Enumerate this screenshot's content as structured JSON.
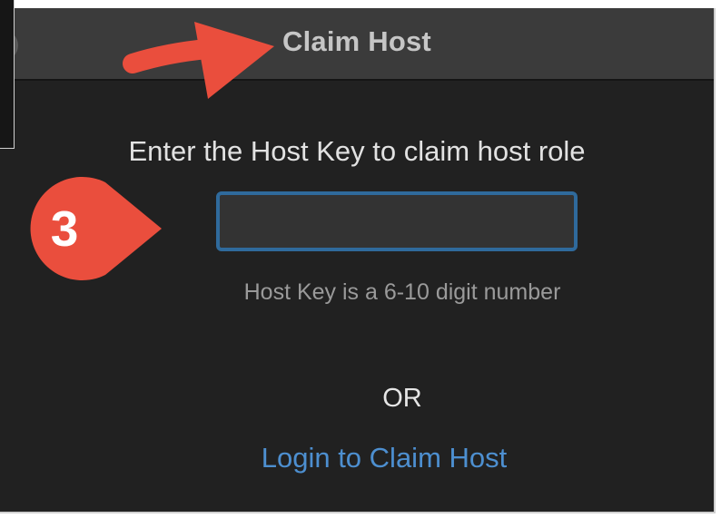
{
  "window": {
    "title": "Claim Host"
  },
  "content": {
    "prompt": "Enter the Host Key to claim host role",
    "host_key_input": {
      "value": "",
      "placeholder": ""
    },
    "hint": "Host Key is a 6-10 digit number",
    "or_divider": "OR",
    "login_link": "Login to Claim Host"
  },
  "annotations": {
    "step_number": "3",
    "step_marker_color": "#ea4e3d",
    "arrow_color": "#ea4e3d",
    "step_marker_icon": "teardrop-pin-icon",
    "arrow_icon": "arrow-right-icon"
  },
  "colors": {
    "window_background": "#212121",
    "titlebar_background": "#3b3b3b",
    "input_border": "#2f6a9c",
    "link": "#4d8fd0"
  }
}
